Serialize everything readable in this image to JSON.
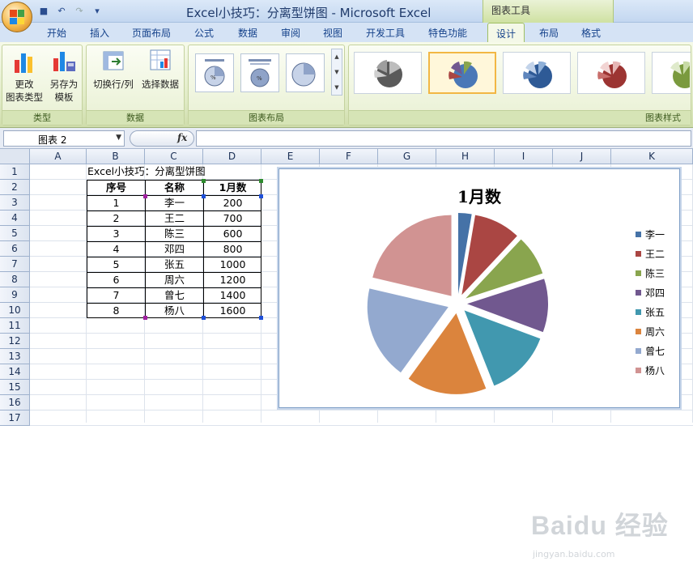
{
  "window": {
    "title": "Excel小技巧：分离型饼图 - Microsoft Excel",
    "context_tools": "图表工具"
  },
  "tabs": [
    "开始",
    "插入",
    "页面布局",
    "公式",
    "数据",
    "审阅",
    "视图",
    "开发工具",
    "特色功能",
    "设计",
    "布局",
    "格式"
  ],
  "active_tab": "设计",
  "ribbon": {
    "groups": {
      "type": "类型",
      "data": "数据",
      "layout": "图表布局",
      "styles": "图表样式"
    },
    "buttons": {
      "change_type": "更改\n图表类型",
      "save_template": "另存为\n模板",
      "switch_row_col": "切换行/列",
      "select_data": "选择数据"
    }
  },
  "formula_bar": {
    "name_box": "图表 2",
    "fx": "fx",
    "formula": ""
  },
  "sheet": {
    "columns": [
      "A",
      "B",
      "C",
      "D",
      "E",
      "F",
      "G",
      "H",
      "I",
      "J",
      "K"
    ],
    "rows": [
      "1",
      "2",
      "3",
      "4",
      "5",
      "6",
      "7",
      "8",
      "9",
      "10",
      "11",
      "12",
      "13",
      "14",
      "15",
      "16",
      "17"
    ],
    "b1": "Excel小技巧：分离型饼图",
    "headers": [
      "序号",
      "名称",
      "1月数"
    ],
    "data": [
      [
        "1",
        "李一",
        "200"
      ],
      [
        "2",
        "王二",
        "700"
      ],
      [
        "3",
        "陈三",
        "600"
      ],
      [
        "4",
        "邓四",
        "800"
      ],
      [
        "5",
        "张五",
        "1000"
      ],
      [
        "6",
        "周六",
        "1200"
      ],
      [
        "7",
        "曾七",
        "1400"
      ],
      [
        "8",
        "杨八",
        "1600"
      ]
    ]
  },
  "chart_data": {
    "type": "pie",
    "title": "1月数",
    "categories": [
      "李一",
      "王二",
      "陈三",
      "邓四",
      "张五",
      "周六",
      "曾七",
      "杨八"
    ],
    "values": [
      200,
      700,
      600,
      800,
      1000,
      1200,
      1400,
      1600
    ],
    "colors": [
      "#4572a7",
      "#aa4643",
      "#89a54e",
      "#71588f",
      "#4198af",
      "#db843d",
      "#93a9cf",
      "#d19392"
    ],
    "exploded": true,
    "legend": "right"
  },
  "watermark": {
    "text": "Baidu 经验",
    "sub": "jingyan.baidu.com"
  }
}
